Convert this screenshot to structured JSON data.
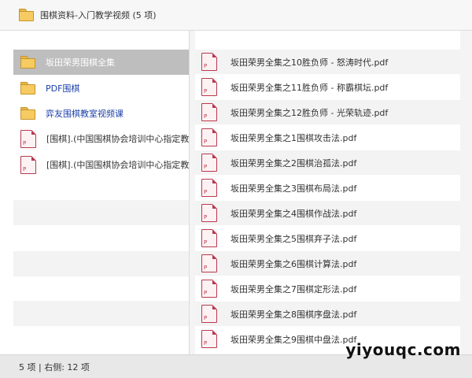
{
  "window": {
    "title": "围棋资料-入门教学视频 (5 项)"
  },
  "left_pane": {
    "items": [
      {
        "label": "坂田荣男围棋全集",
        "icon": "folder-icon",
        "selected": true
      },
      {
        "label": "PDF围棋",
        "icon": "folder-icon",
        "selected": false
      },
      {
        "label": "弈友围棋教室视频课",
        "icon": "folder-icon",
        "selected": false
      },
      {
        "label": "[围棋].(中国围棋协会培训中心指定教材",
        "icon": "pdf-file-icon",
        "selected": false
      },
      {
        "label": "[围棋].(中国围棋协会培训中心指定教材",
        "icon": "pdf-file-icon",
        "selected": false
      }
    ]
  },
  "right_pane": {
    "items": [
      {
        "label": "坂田荣男全集之10胜负师 - 怒涛时代.pdf",
        "icon": "pdf-file-icon"
      },
      {
        "label": "坂田荣男全集之11胜负师 - 称霸棋坛.pdf",
        "icon": "pdf-file-icon"
      },
      {
        "label": "坂田荣男全集之12胜负师 - 光荣轨迹.pdf",
        "icon": "pdf-file-icon"
      },
      {
        "label": "坂田荣男全集之1围棋攻击法.pdf",
        "icon": "pdf-file-icon"
      },
      {
        "label": "坂田荣男全集之2围棋治孤法.pdf",
        "icon": "pdf-file-icon"
      },
      {
        "label": "坂田荣男全集之3围棋布局法.pdf",
        "icon": "pdf-file-icon"
      },
      {
        "label": "坂田荣男全集之4围棋作战法.pdf",
        "icon": "pdf-file-icon"
      },
      {
        "label": "坂田荣男全集之5围棋弃子法.pdf",
        "icon": "pdf-file-icon"
      },
      {
        "label": "坂田荣男全集之6围棋计算法.pdf",
        "icon": "pdf-file-icon"
      },
      {
        "label": "坂田荣男全集之7围棋定形法.pdf",
        "icon": "pdf-file-icon"
      },
      {
        "label": "坂田荣男全集之8围棋序盘法.pdf",
        "icon": "pdf-file-icon"
      },
      {
        "label": "坂田荣男全集之9围棋中盘法.pdf",
        "icon": "pdf-file-icon"
      }
    ]
  },
  "status_bar": {
    "text": "5 项 | 右侧: 12 项"
  },
  "watermark": {
    "text": "yiyouqc.com"
  },
  "colors": {
    "selection": "#bebebe",
    "link_text": "#1b3fa8",
    "folder": "#f6cb62",
    "pdf_icon": "#b73a4f"
  }
}
